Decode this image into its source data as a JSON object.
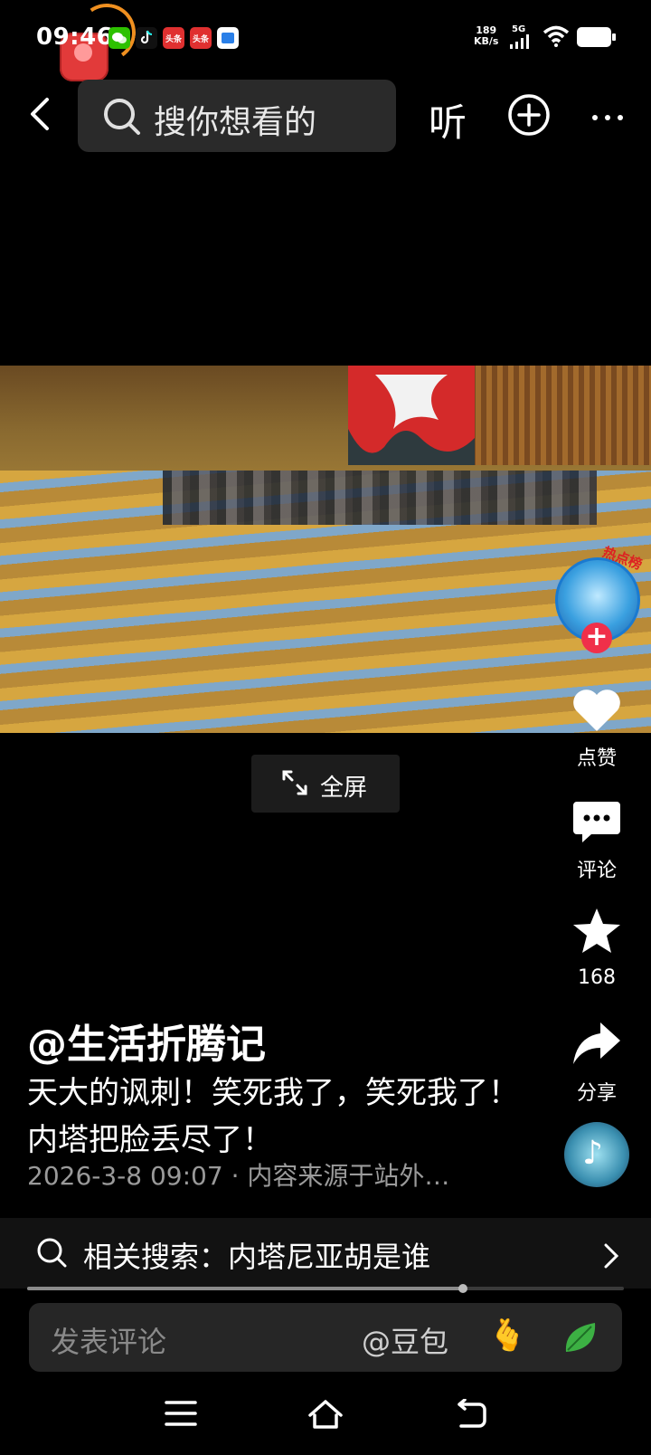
{
  "status_bar": {
    "time": "09:46",
    "app_icons": [
      "wechat-icon",
      "tiktok-icon",
      "toutiao-icon",
      "toutiao-icon",
      "app-icon"
    ],
    "app_icon_labels": [
      "头条",
      "头条"
    ],
    "net_speed_value": "189",
    "net_speed_unit": "KB/s",
    "network": "5G",
    "colors": {
      "wechat": "#2dc100",
      "toutiao": "#e03030",
      "tiktok": "#111111",
      "blue_app": "#2a7fe8"
    }
  },
  "top_bar": {
    "search_placeholder": "搜你想看的",
    "listen_label": "听"
  },
  "video": {
    "fullscreen_label": "全屏"
  },
  "right_rail": {
    "avatar_tag": "热点榜",
    "like_label": "点赞",
    "comment_label": "评论",
    "favorite_count": "168",
    "share_label": "分享"
  },
  "caption": {
    "author": "@生活折腾记",
    "description": "天大的讽刺！笑死我了，笑死我了！内塔把脸丢尽了！",
    "meta": "2026-3-8 09:07 · 内容来源于站外…"
  },
  "related_search": {
    "text": "相关搜索：内塔尼亚胡是谁"
  },
  "progress": {
    "fraction": 0.73
  },
  "comment_bar": {
    "placeholder": "发表评论",
    "mention": "@豆包"
  },
  "colors": {
    "background": "#000000",
    "accent_red": "#f0304a"
  }
}
